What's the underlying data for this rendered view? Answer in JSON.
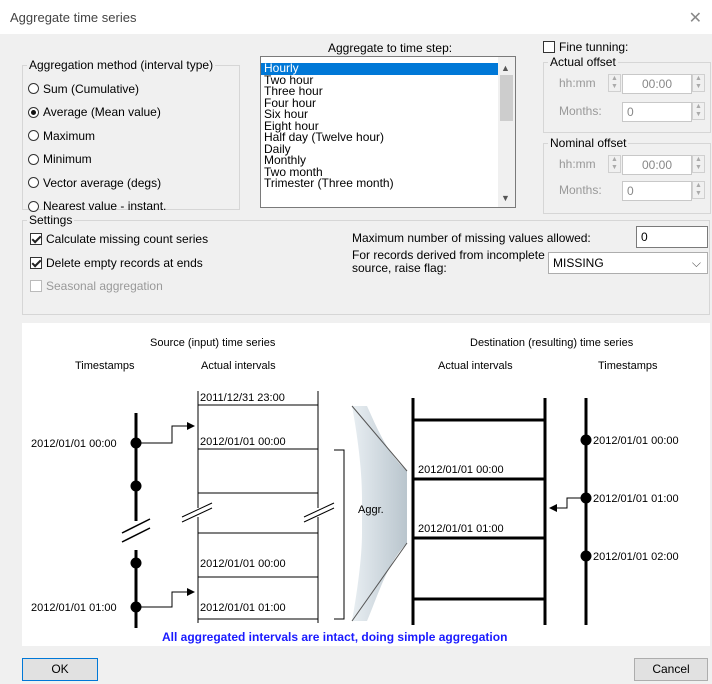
{
  "window": {
    "title": "Aggregate time series",
    "close_icon": "close-icon"
  },
  "aggregation_method": {
    "legend": "Aggregation method (interval type)",
    "options": [
      {
        "label": "Sum (Cumulative)",
        "selected": false
      },
      {
        "label": "Average (Mean value)",
        "selected": true
      },
      {
        "label": "Maximum",
        "selected": false
      },
      {
        "label": "Minimum",
        "selected": false
      },
      {
        "label": "Vector average (degs)",
        "selected": false
      },
      {
        "label": "Nearest value - instant.",
        "selected": false
      }
    ]
  },
  "time_step": {
    "label": "Aggregate to time step:",
    "items": [
      "Hourly",
      "Two hour",
      "Three hour",
      "Four hour",
      "Six hour",
      "Eight hour",
      "Half day (Twelve hour)",
      "Daily",
      "Monthly",
      "Two month",
      "Trimester (Three month)"
    ],
    "selected": "Hourly"
  },
  "fine_tuning": {
    "label": "Fine tunning:",
    "checked": false
  },
  "actual_offset": {
    "legend": "Actual offset",
    "time_label": "hh:mm",
    "time_value": "00:00",
    "months_label": "Months:",
    "months_value": "0"
  },
  "nominal_offset": {
    "legend": "Nominal offset",
    "time_label": "hh:mm",
    "time_value": "00:00",
    "months_label": "Months:",
    "months_value": "0"
  },
  "settings": {
    "legend": "Settings",
    "calc_missing": {
      "label": "Calculate missing count series",
      "checked": true
    },
    "delete_empty": {
      "label": "Delete empty records at ends",
      "checked": true
    },
    "seasonal": {
      "label": "Seasonal aggregation",
      "checked": false,
      "disabled": true
    },
    "max_missing_label": "Maximum number of missing values allowed:",
    "max_missing_value": "0",
    "incomplete_label_1": "For records derived from incomplete",
    "incomplete_label_2": "source, raise flag:",
    "flag_value": "MISSING"
  },
  "diagram": {
    "source_title": "Source (input) time series",
    "dest_title": "Destination (resulting) time series",
    "timestamps_label": "Timestamps",
    "actual_intervals_label": "Actual intervals",
    "src_interval_1": "2011/12/31 23:00",
    "src_interval_2": "2012/01/01 00:00",
    "src_interval_3": "2012/01/01 00:00",
    "src_interval_4": "2012/01/01 01:00",
    "src_stamp_1": "2012/01/01 00:00",
    "src_stamp_2": "2012/01/01 01:00",
    "aggr_label": "Aggr.",
    "dst_interval_1": "2012/01/01 00:00",
    "dst_interval_2": "2012/01/01 01:00",
    "dst_stamp_1": "2012/01/01 00:00",
    "dst_stamp_2": "2012/01/01 01:00",
    "dst_stamp_3": "2012/01/01 02:00",
    "status_message": "All aggregated intervals are intact, doing simple aggregation",
    "status_color": "#1a1aff"
  },
  "buttons": {
    "ok": "OK",
    "cancel": "Cancel"
  },
  "colors": {
    "accent": "#0078d7"
  }
}
